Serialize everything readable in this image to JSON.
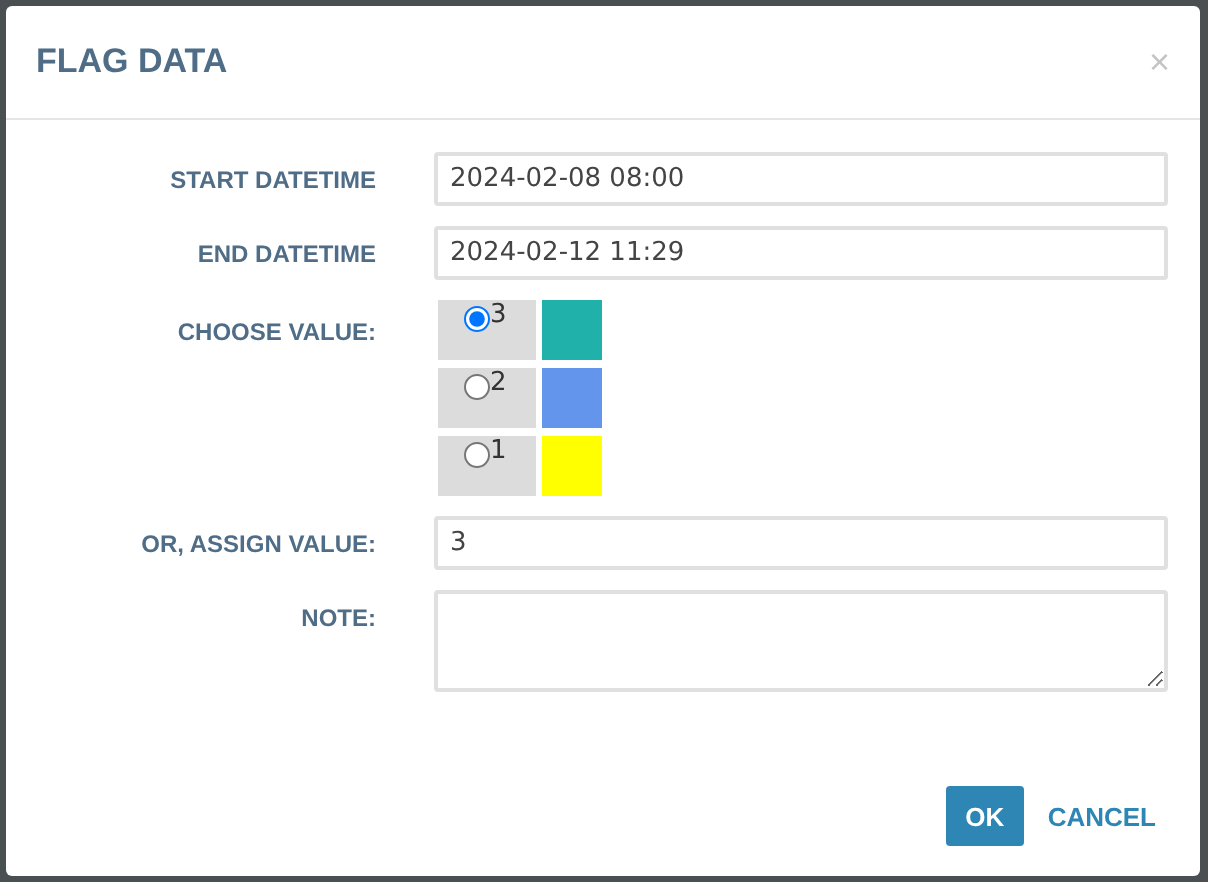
{
  "dialog": {
    "title": "FLAG DATA",
    "close": "×"
  },
  "fields": [
    {
      "kind": "text",
      "label": "START DATETIME",
      "value": "2024-02-08 08:00"
    },
    {
      "kind": "text",
      "label": "END DATETIME",
      "value": "2024-02-12 11:29"
    },
    {
      "kind": "choice",
      "label": "CHOOSE VALUE:",
      "options": [
        {
          "label": "3",
          "selected": true,
          "color": "#20b2aa"
        },
        {
          "label": "2",
          "selected": false,
          "color": "#6495ed"
        },
        {
          "label": "1",
          "selected": false,
          "color": "#ffff00"
        }
      ]
    },
    {
      "kind": "text",
      "label": "OR, ASSIGN VALUE:",
      "value": "3"
    },
    {
      "kind": "textarea",
      "label": "NOTE:"
    }
  ],
  "buttons": [
    {
      "kind": "primary",
      "label": "OK"
    },
    {
      "kind": "link",
      "label": "CANCEL"
    }
  ]
}
